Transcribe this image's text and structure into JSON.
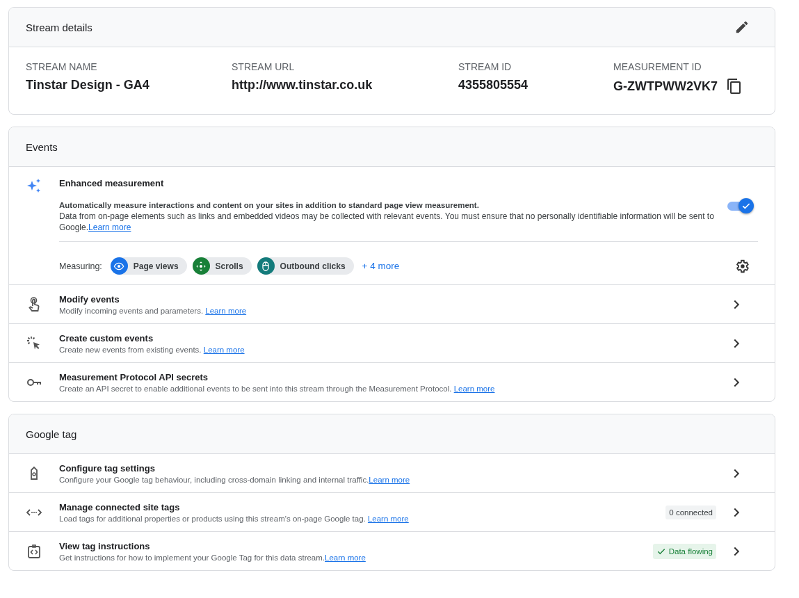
{
  "stream_details": {
    "title": "Stream details",
    "fields": [
      {
        "label": "STREAM NAME",
        "value": "Tinstar Design - GA4"
      },
      {
        "label": "STREAM URL",
        "value": "http://www.tinstar.co.uk"
      },
      {
        "label": "STREAM ID",
        "value": "4355805554"
      },
      {
        "label": "MEASUREMENT ID",
        "value": "G-ZWTPWW2VK7"
      }
    ]
  },
  "events": {
    "title": "Events",
    "enhanced": {
      "title": "Enhanced measurement",
      "lead": "Automatically measure interactions and content on your sites in addition to standard page view measurement.",
      "body": "Data from on-page elements such as links and embedded videos may be collected with relevant events. You must ensure that no personally identifiable information will be sent to Google.",
      "link": "Learn more",
      "enabled": true,
      "measuring_label": "Measuring:",
      "chips": [
        {
          "label": "Page views",
          "color": "#1a73e8"
        },
        {
          "label": "Scrolls",
          "color": "#188038"
        },
        {
          "label": "Outbound clicks",
          "color": "#137b7b"
        }
      ],
      "more": "+ 4 more"
    },
    "rows": [
      {
        "title": "Modify events",
        "description": "Modify incoming events and parameters. ",
        "link": "Learn more"
      },
      {
        "title": "Create custom events",
        "description": "Create new events from existing events. ",
        "link": "Learn more"
      },
      {
        "title": "Measurement Protocol API secrets",
        "description": "Create an API secret to enable additional events to be sent into this stream through the Measurement Protocol. ",
        "link": "Learn more"
      }
    ]
  },
  "google_tag": {
    "title": "Google tag",
    "rows": [
      {
        "title": "Configure tag settings",
        "description": "Configure your Google tag behaviour, including cross-domain linking and internal traffic.",
        "link": "Learn more"
      },
      {
        "title": "Manage connected site tags",
        "description": "Load tags for additional properties or products using this stream's on-page Google tag. ",
        "link": "Learn more",
        "badge": {
          "text": "0 connected",
          "kind": "neutral"
        }
      },
      {
        "title": "View tag instructions",
        "description": "Get instructions for how to implement your Google Tag for this data stream.",
        "link": "Learn more",
        "badge": {
          "text": "Data flowing",
          "kind": "success"
        }
      }
    ]
  }
}
